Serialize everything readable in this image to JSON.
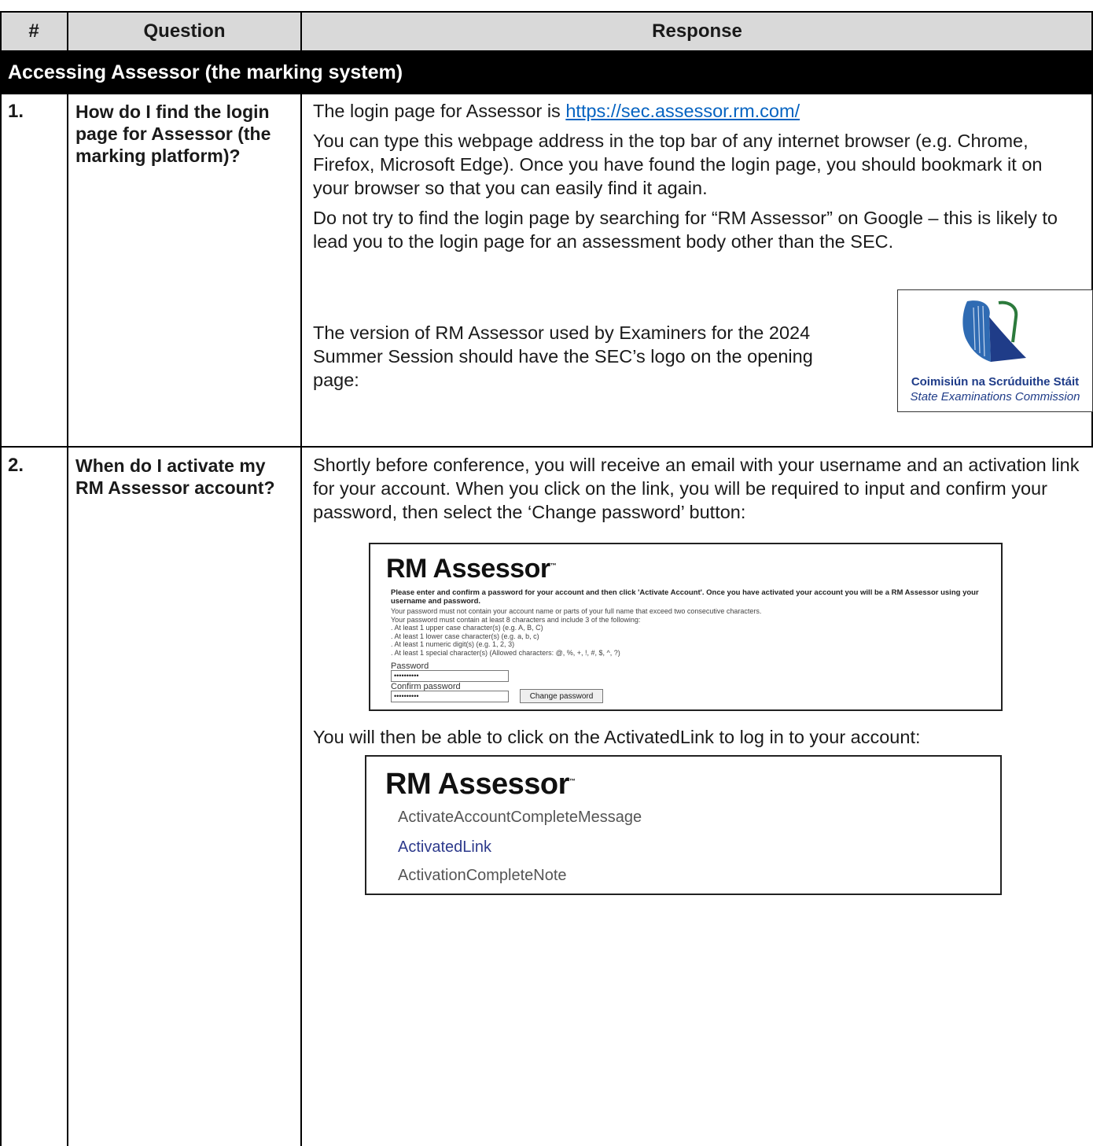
{
  "table": {
    "headers": {
      "num": "#",
      "question": "Question",
      "response": "Response"
    },
    "section_title": "Accessing Assessor (the marking system)",
    "rows": [
      {
        "num": "1.",
        "question": "How do I find the login page for Assessor (the marking platform)?",
        "response": {
          "p1_text": "The login page for Assessor is ",
          "p1_link": "https://sec.assessor.rm.com/",
          "p2": "You can type this webpage address in the top bar of any internet browser (e.g. Chrome, Firefox, Microsoft Edge).  Once you have found the login page, you should bookmark it on your browser so that you can easily find it again.",
          "p3": "Do not try to find the login page by searching for “RM Assessor” on Google – this is likely to lead you to the login page for an assessment body other than the SEC.",
          "p4": "The version of RM Assessor used by Examiners for the 2024 Summer Session should have the SEC’s logo on the opening page:"
        }
      },
      {
        "num": "2.",
        "question": "When do I activate my RM Assessor account?",
        "response": {
          "p1": "Shortly before conference, you will receive an email with your username and an activation link for your account.  When you click on the link, you will be required to input and confirm your password, then select the ‘Change password’ button:",
          "p2": "You will then be able to click on the ActivatedLink to log in to your account:"
        }
      }
    ]
  },
  "sec_logo": {
    "irish": "Coimisiún na Scrúduithe Stáit",
    "english": "State Examinations Commission",
    "colors": {
      "navy": "#1f3c88",
      "blue": "#2f6bb3",
      "green": "#2c7a3c"
    }
  },
  "activate_screenshot": {
    "brand": "RM Assessor",
    "brand_mark": "™",
    "intro": "Please enter and confirm a password for your account and then click 'Activate Account'. Once you have activated your account you will be a RM Assessor using your username and password.",
    "rules": [
      "Your password must not contain your account name or parts of your full name that exceed two consecutive characters.",
      "Your password must contain at least 8 characters and include 3 of the following:",
      ". At least 1 upper case character(s) (e.g. A, B, C)",
      ". At least 1 lower case character(s) (e.g. a, b, c)",
      ". At least 1 numeric digit(s) (e.g. 1, 2, 3)",
      ". At least 1 special character(s) (Allowed characters: @, %, +, !, #, $, ^, ?)"
    ],
    "password_label": "Password",
    "password_value": "••••••••••",
    "confirm_label": "Confirm password",
    "confirm_value": "••••••••••",
    "button_label": "Change password"
  },
  "complete_screenshot": {
    "brand": "RM Assessor",
    "brand_mark": "™",
    "message": "ActivateAccountCompleteMessage",
    "link": "ActivatedLink",
    "note": "ActivationCompleteNote"
  }
}
